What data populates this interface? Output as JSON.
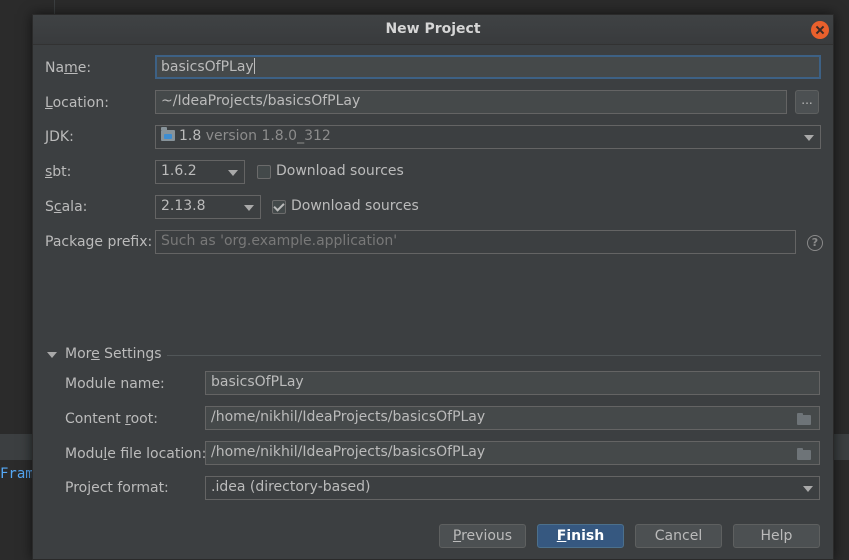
{
  "background": {
    "code_fragment": "Fram"
  },
  "dialog": {
    "title": "New Project"
  },
  "form": {
    "name": {
      "label_pre": "Na",
      "label_ul": "m",
      "label_post": "e:",
      "value": "basicsOfPLay"
    },
    "location": {
      "label_pre": "",
      "label_ul": "L",
      "label_post": "ocation:",
      "value": "~/IdeaProjects/basicsOfPLay",
      "browse_label": "..."
    },
    "jdk": {
      "label_pre": "",
      "label_ul": "J",
      "label_post": "DK:",
      "name": "1.8",
      "version": "version 1.8.0_312"
    },
    "sbt": {
      "label_pre": "",
      "label_ul": "s",
      "label_post": "bt:",
      "value": "1.6.2",
      "download_sources_label": "Download sources",
      "download_sources_checked": false
    },
    "scala": {
      "label_pre": "S",
      "label_ul": "c",
      "label_post": "ala:",
      "value": "2.13.8",
      "download_sources_label": "Download sources",
      "download_sources_checked": true
    },
    "package_prefix": {
      "label": "Package prefix:",
      "placeholder": "Such as 'org.example.application'",
      "help": "?"
    }
  },
  "more_settings": {
    "title_pre": "Mor",
    "title_ul": "e",
    "title_post": " Settings",
    "module_name": {
      "label": "Module name:",
      "value": "basicsOfPLay"
    },
    "content_root": {
      "label_pre": "Content ",
      "label_ul": "r",
      "label_post": "oot:",
      "value": "/home/nikhil/IdeaProjects/basicsOfPLay"
    },
    "module_file_location": {
      "label_pre": "Modu",
      "label_ul": "l",
      "label_post": "e file location:",
      "value": "/home/nikhil/IdeaProjects/basicsOfPLay"
    },
    "project_format": {
      "label": "Project format:",
      "value": ".idea (directory-based)"
    }
  },
  "buttons": {
    "previous_ul": "P",
    "previous_post": "revious",
    "finish_ul": "F",
    "finish_post": "inish",
    "cancel": "Cancel",
    "help": "Help"
  }
}
